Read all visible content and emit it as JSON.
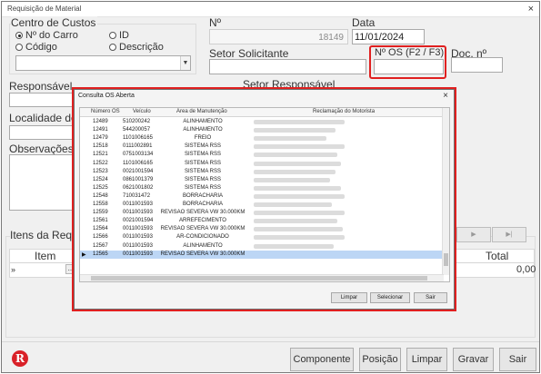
{
  "window": {
    "title": "Requisição de Material",
    "close": "×"
  },
  "centro_custos": {
    "label": "Centro de Custos",
    "options": [
      {
        "label": "Nº do Carro",
        "checked": true
      },
      {
        "label": "ID",
        "checked": false
      },
      {
        "label": "Código",
        "checked": false
      },
      {
        "label": "Descrição",
        "checked": false
      }
    ],
    "combo_value": ""
  },
  "numero": {
    "label": "Nº",
    "value": "18149"
  },
  "data": {
    "label": "Data",
    "value": "11/01/2024"
  },
  "setor_solicitante": {
    "label": "Setor Solicitante",
    "value": ""
  },
  "os": {
    "label": "Nº OS (F2 / F3)",
    "value": ""
  },
  "doc": {
    "label": "Doc. nº",
    "value": ""
  },
  "responsavel": {
    "label": "Responsável"
  },
  "setor_responsavel": {
    "label": "Setor Responsável"
  },
  "localidade": {
    "label": "Localidade de D"
  },
  "observacoes": {
    "label": "Observações"
  },
  "itens": {
    "label": "Itens da Requisiç",
    "columns": [
      "Item",
      "Total"
    ],
    "row_marker": "»",
    "ellipsis": "...",
    "total_value": "0,00",
    "nav_next": "▶",
    "nav_last": "▶|"
  },
  "buttons": {
    "componente": "Componente",
    "posicao": "Posição",
    "limpar": "Limpar",
    "gravar": "Gravar",
    "sair": "Sair"
  },
  "logo": {
    "letter": "R",
    "color": "#d92128"
  },
  "dialog": {
    "title": "Consulta OS Aberta",
    "close": "×",
    "columns": [
      "Número OS",
      "Veículo",
      "Área de Manutenção",
      "Reclamação do Motorista"
    ],
    "rows": [
      {
        "os": "12489",
        "veiculo": "510200242",
        "area": "ALINHAMENTO"
      },
      {
        "os": "12491",
        "veiculo": "544200057",
        "area": "ALINHAMENTO"
      },
      {
        "os": "12479",
        "veiculo": "1101006165",
        "area": "FREIO"
      },
      {
        "os": "12518",
        "veiculo": "0111002891",
        "area": "SISTEMA RSS"
      },
      {
        "os": "12521",
        "veiculo": "0751003134",
        "area": "SISTEMA RSS"
      },
      {
        "os": "12522",
        "veiculo": "1101006165",
        "area": "SISTEMA RSS"
      },
      {
        "os": "12523",
        "veiculo": "0021001594",
        "area": "SISTEMA RSS"
      },
      {
        "os": "12524",
        "veiculo": "0861001379",
        "area": "SISTEMA RSS"
      },
      {
        "os": "12525",
        "veiculo": "0621001802",
        "area": "SISTEMA RSS"
      },
      {
        "os": "12548",
        "veiculo": "710031472",
        "area": "BORRACHARIA"
      },
      {
        "os": "12558",
        "veiculo": "0011001593",
        "area": "BORRACHARIA"
      },
      {
        "os": "12559",
        "veiculo": "0011001593",
        "area": "REVISAO SEVERA VW 30.000KM"
      },
      {
        "os": "12561",
        "veiculo": "0021001594",
        "area": "ARREFECIMENTO"
      },
      {
        "os": "12564",
        "veiculo": "0011001593",
        "area": "REVISAO SEVERA VW 30.000KM"
      },
      {
        "os": "12566",
        "veiculo": "0011001593",
        "area": "AR-CONDICIONADO"
      },
      {
        "os": "12567",
        "veiculo": "0011001593",
        "area": "ALINHAMENTO"
      },
      {
        "os": "12565",
        "veiculo": "0011001593",
        "area": "REVISAO SEVERA VW 30.000KM"
      }
    ],
    "selected_index": 16,
    "current_marker": "▶",
    "buttons": {
      "limpar": "Limpar",
      "selecionar": "Selecionar",
      "sair": "Sair"
    }
  },
  "colors": {
    "highlight": "#e02020",
    "selection": "#bcd6f5"
  }
}
